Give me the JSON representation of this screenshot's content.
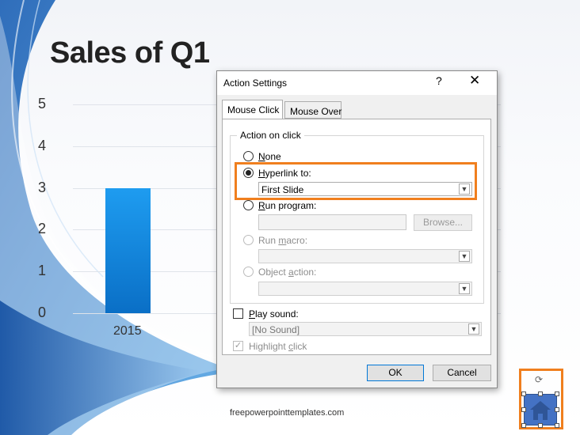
{
  "slide": {
    "title": "Sales of Q1",
    "footer": "freepowerpointtemplates.com",
    "colors": {
      "bar": "#1e88e5",
      "highlight": "#f07f1e",
      "home_button": "#4472c4"
    }
  },
  "chart_data": {
    "type": "bar",
    "categories": [
      "2015"
    ],
    "values": [
      3
    ],
    "ylim": [
      0,
      5
    ],
    "y_ticks": [
      "0",
      "1",
      "2",
      "3",
      "4",
      "5"
    ],
    "grid": true
  },
  "dialog": {
    "title": "Action Settings",
    "help_label": "?",
    "close_label": "✕",
    "tabs": [
      {
        "label": "Mouse Click",
        "active": true
      },
      {
        "label": "Mouse Over",
        "active": false
      }
    ],
    "group_label": "Action on click",
    "options": {
      "none": {
        "accel": "N",
        "rest": "one"
      },
      "hyperlink": {
        "accel": "H",
        "rest": "yperlink to:",
        "value": "First Slide",
        "selected": true
      },
      "run_program": {
        "accel": "R",
        "rest": "un program:",
        "browse_label": "Browse..."
      },
      "run_macro": {
        "pre": "Run ",
        "accel": "m",
        "rest": "acro:"
      },
      "object_action": {
        "pre": "Object ",
        "accel": "a",
        "rest": "ction:"
      }
    },
    "play_sound": {
      "accel": "P",
      "rest": "lay sound:",
      "value": "[No Sound]",
      "checked": false
    },
    "highlight_click": {
      "pre": "Highlight ",
      "accel": "c",
      "rest": "lick",
      "checked": true
    },
    "ok_label": "OK",
    "cancel_label": "Cancel"
  }
}
